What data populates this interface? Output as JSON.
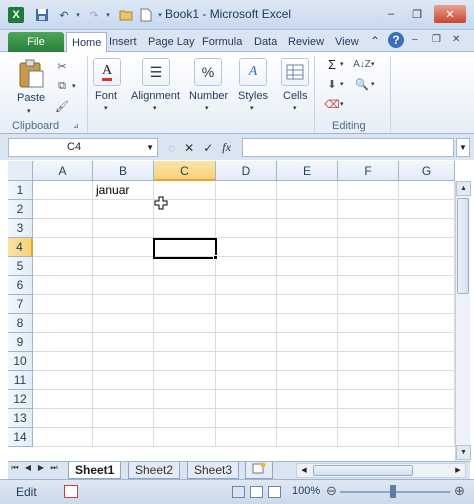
{
  "window": {
    "title": "Book1  -  Microsoft Excel",
    "minimize": "–",
    "maximize": "❐",
    "close": "✕"
  },
  "ribbon_tabs": [
    "File",
    "Home",
    "Insert",
    "Page Lay",
    "Formula",
    "Data",
    "Review",
    "View"
  ],
  "ribbon": {
    "clipboard": {
      "paste": "Paste",
      "group": "Clipboard"
    },
    "font": {
      "label": "Font"
    },
    "alignment": {
      "label": "Alignment"
    },
    "number": {
      "label": "Number"
    },
    "styles": {
      "label": "Styles"
    },
    "cells": {
      "label": "Cells"
    },
    "editing": {
      "group": "Editing"
    }
  },
  "formula_bar": {
    "name_box": "C4",
    "formula": ""
  },
  "grid": {
    "columns": [
      "A",
      "B",
      "C",
      "D",
      "E",
      "F",
      "G"
    ],
    "selected_column": "C",
    "rows": [
      "1",
      "2",
      "3",
      "4",
      "5",
      "6",
      "7",
      "8",
      "9",
      "10",
      "11",
      "12",
      "13",
      "14"
    ],
    "selected_row": "4",
    "cells": {
      "B1": "januar"
    }
  },
  "sheets": [
    "Sheet1",
    "Sheet2",
    "Sheet3"
  ],
  "active_sheet": "Sheet1",
  "status": {
    "mode": "Edit",
    "zoom": "100%"
  },
  "colors": {
    "file_tab": "#2a7f3a",
    "selection_header": "#f9d27a",
    "ribbon_bg": "#dbe5f1"
  }
}
